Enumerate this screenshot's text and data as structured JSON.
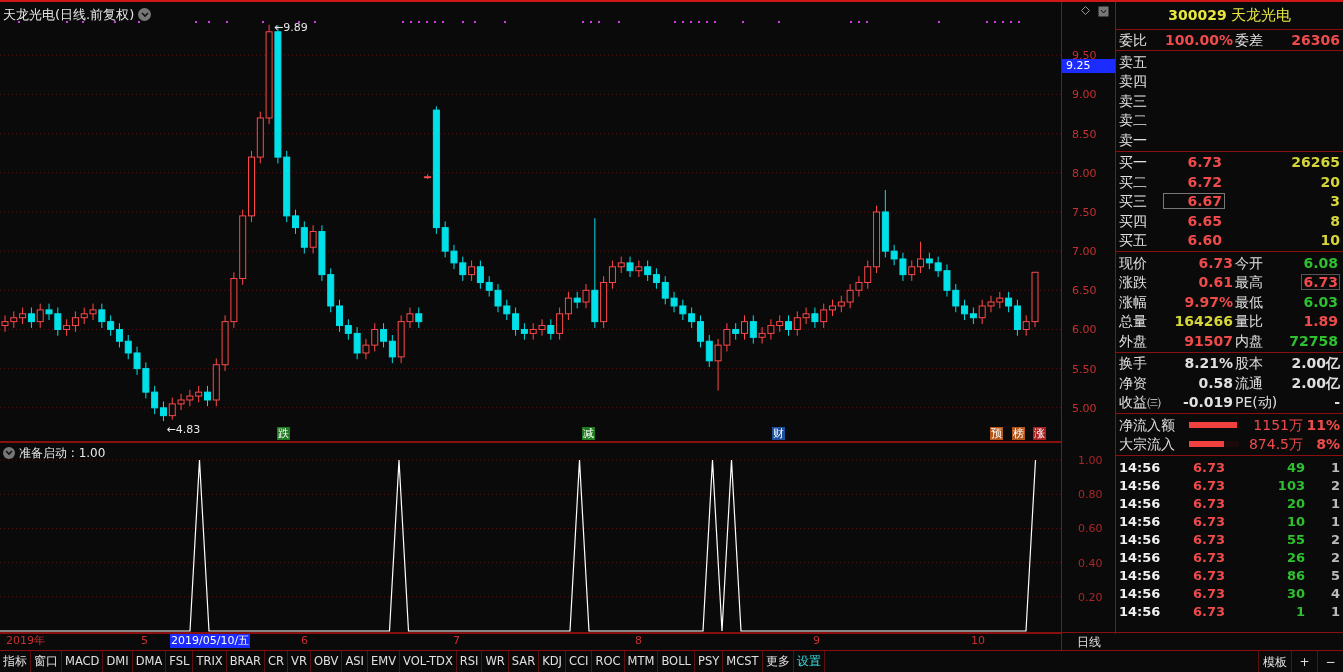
{
  "chart_title": "天龙光电(日线.前复权)",
  "price_chart": {
    "high_label": "←9.89",
    "low_label": "←4.83",
    "cursor_price": "9.25",
    "chart_data": {
      "type": "candlestick",
      "ylim": [
        4.57,
        10.18
      ],
      "grid": true,
      "yticks": [
        {
          "value": 9.5,
          "label": "9.50"
        },
        {
          "value": 9.0,
          "label": "9.00"
        },
        {
          "value": 8.5,
          "label": "8.50"
        },
        {
          "value": 8.0,
          "label": "8.00"
        },
        {
          "value": 7.5,
          "label": "7.50"
        },
        {
          "value": 7.0,
          "label": "7.00"
        },
        {
          "value": 6.5,
          "label": "6.50"
        },
        {
          "value": 6.0,
          "label": "6.00"
        },
        {
          "value": 5.5,
          "label": "5.50"
        },
        {
          "value": 5.0,
          "label": "5.00"
        }
      ],
      "ohlc": [
        [
          6.05,
          6.18,
          5.97,
          6.1
        ],
        [
          6.1,
          6.23,
          6.02,
          6.15
        ],
        [
          6.15,
          6.28,
          6.07,
          6.2
        ],
        [
          6.2,
          6.28,
          6.02,
          6.1
        ],
        [
          6.1,
          6.33,
          6.02,
          6.25
        ],
        [
          6.25,
          6.33,
          6.12,
          6.2
        ],
        [
          6.2,
          6.28,
          5.92,
          6.0
        ],
        [
          6.0,
          6.13,
          5.92,
          6.05
        ],
        [
          6.05,
          6.23,
          5.97,
          6.15
        ],
        [
          6.15,
          6.28,
          6.07,
          6.2
        ],
        [
          6.2,
          6.33,
          6.12,
          6.25
        ],
        [
          6.25,
          6.33,
          6.02,
          6.1
        ],
        [
          6.1,
          6.18,
          5.92,
          6.0
        ],
        [
          6.0,
          6.08,
          5.77,
          5.85
        ],
        [
          5.85,
          5.93,
          5.62,
          5.7
        ],
        [
          5.7,
          5.78,
          5.42,
          5.5
        ],
        [
          5.5,
          5.58,
          5.12,
          5.2
        ],
        [
          5.2,
          5.28,
          4.92,
          5.0
        ],
        [
          5.0,
          5.08,
          4.83,
          4.9
        ],
        [
          4.9,
          5.13,
          4.85,
          5.05
        ],
        [
          5.05,
          5.18,
          4.97,
          5.1
        ],
        [
          5.1,
          5.23,
          5.02,
          5.15
        ],
        [
          5.15,
          5.28,
          5.07,
          5.2
        ],
        [
          5.2,
          5.28,
          5.02,
          5.1
        ],
        [
          5.1,
          5.63,
          5.02,
          5.55
        ],
        [
          5.55,
          6.18,
          5.47,
          6.1
        ],
        [
          6.1,
          6.73,
          6.02,
          6.65
        ],
        [
          6.65,
          7.53,
          6.57,
          7.45
        ],
        [
          7.45,
          8.28,
          7.37,
          8.2
        ],
        [
          8.2,
          8.78,
          8.12,
          8.7
        ],
        [
          8.7,
          9.89,
          8.62,
          9.8
        ],
        [
          9.8,
          9.88,
          8.12,
          8.2
        ],
        [
          8.2,
          8.28,
          7.37,
          7.45
        ],
        [
          7.45,
          7.53,
          7.22,
          7.3
        ],
        [
          7.3,
          7.38,
          6.97,
          7.05
        ],
        [
          7.05,
          7.33,
          6.97,
          7.25
        ],
        [
          7.25,
          7.33,
          6.62,
          6.7
        ],
        [
          6.7,
          6.78,
          6.22,
          6.3
        ],
        [
          6.3,
          6.38,
          5.97,
          6.05
        ],
        [
          6.05,
          6.13,
          5.87,
          5.95
        ],
        [
          5.95,
          6.03,
          5.62,
          5.7
        ],
        [
          5.7,
          5.88,
          5.62,
          5.8
        ],
        [
          5.8,
          6.08,
          5.72,
          6.0
        ],
        [
          6.0,
          6.08,
          5.77,
          5.85
        ],
        [
          5.85,
          5.93,
          5.57,
          5.65
        ],
        [
          5.65,
          6.18,
          5.57,
          6.1
        ],
        [
          6.1,
          6.28,
          6.02,
          6.2
        ],
        [
          6.2,
          6.28,
          6.02,
          6.1
        ],
        [
          7.95,
          7.98,
          7.92,
          7.95
        ],
        [
          8.8,
          8.85,
          7.22,
          7.3
        ],
        [
          7.3,
          7.38,
          6.92,
          7.0
        ],
        [
          7.0,
          7.08,
          6.77,
          6.85
        ],
        [
          6.85,
          6.93,
          6.62,
          6.7
        ],
        [
          6.7,
          6.88,
          6.62,
          6.8
        ],
        [
          6.8,
          6.88,
          6.52,
          6.6
        ],
        [
          6.6,
          6.68,
          6.42,
          6.5
        ],
        [
          6.5,
          6.58,
          6.22,
          6.3
        ],
        [
          6.3,
          6.38,
          6.12,
          6.2
        ],
        [
          6.2,
          6.28,
          5.92,
          6.0
        ],
        [
          6.0,
          6.08,
          5.87,
          5.95
        ],
        [
          5.95,
          6.08,
          5.87,
          6.0
        ],
        [
          6.0,
          6.13,
          5.92,
          6.05
        ],
        [
          6.05,
          6.13,
          5.87,
          5.95
        ],
        [
          5.95,
          6.28,
          5.87,
          6.2
        ],
        [
          6.2,
          6.48,
          6.12,
          6.4
        ],
        [
          6.4,
          6.48,
          6.27,
          6.35
        ],
        [
          6.35,
          6.58,
          6.27,
          6.5
        ],
        [
          6.5,
          7.42,
          6.02,
          6.1
        ],
        [
          6.1,
          6.68,
          6.02,
          6.6
        ],
        [
          6.6,
          6.88,
          6.52,
          6.8
        ],
        [
          6.8,
          6.93,
          6.72,
          6.85
        ],
        [
          6.85,
          6.93,
          6.67,
          6.75
        ],
        [
          6.75,
          6.88,
          6.67,
          6.8
        ],
        [
          6.8,
          6.88,
          6.62,
          6.7
        ],
        [
          6.7,
          6.78,
          6.52,
          6.6
        ],
        [
          6.6,
          6.68,
          6.32,
          6.4
        ],
        [
          6.4,
          6.48,
          6.22,
          6.3
        ],
        [
          6.3,
          6.38,
          6.12,
          6.2
        ],
        [
          6.2,
          6.28,
          6.02,
          6.1
        ],
        [
          6.1,
          6.18,
          5.77,
          5.85
        ],
        [
          5.85,
          5.93,
          5.52,
          5.6
        ],
        [
          5.6,
          5.88,
          5.22,
          5.8
        ],
        [
          5.8,
          6.08,
          5.72,
          6.0
        ],
        [
          6.0,
          6.08,
          5.87,
          5.95
        ],
        [
          5.95,
          6.18,
          5.87,
          6.1
        ],
        [
          6.1,
          6.18,
          5.82,
          5.9
        ],
        [
          5.9,
          6.03,
          5.82,
          5.95
        ],
        [
          5.95,
          6.13,
          5.87,
          6.05
        ],
        [
          6.05,
          6.18,
          5.97,
          6.1
        ],
        [
          6.1,
          6.18,
          5.92,
          6.0
        ],
        [
          6.0,
          6.23,
          5.92,
          6.15
        ],
        [
          6.15,
          6.28,
          6.07,
          6.2
        ],
        [
          6.2,
          6.28,
          6.02,
          6.1
        ],
        [
          6.1,
          6.33,
          6.02,
          6.25
        ],
        [
          6.25,
          6.38,
          6.17,
          6.3
        ],
        [
          6.3,
          6.43,
          6.22,
          6.35
        ],
        [
          6.35,
          6.58,
          6.27,
          6.5
        ],
        [
          6.5,
          6.68,
          6.42,
          6.6
        ],
        [
          6.6,
          6.88,
          6.52,
          6.8
        ],
        [
          6.8,
          7.58,
          6.72,
          7.5
        ],
        [
          7.5,
          7.78,
          6.92,
          7.0
        ],
        [
          7.0,
          7.08,
          6.82,
          6.9
        ],
        [
          6.9,
          6.98,
          6.62,
          6.7
        ],
        [
          6.7,
          6.88,
          6.62,
          6.8
        ],
        [
          6.8,
          7.12,
          6.72,
          6.9
        ],
        [
          6.9,
          6.98,
          6.77,
          6.85
        ],
        [
          6.85,
          6.93,
          6.67,
          6.75
        ],
        [
          6.75,
          6.83,
          6.42,
          6.5
        ],
        [
          6.5,
          6.58,
          6.22,
          6.3
        ],
        [
          6.3,
          6.38,
          6.12,
          6.2
        ],
        [
          6.2,
          6.28,
          6.07,
          6.15
        ],
        [
          6.15,
          6.38,
          6.07,
          6.3
        ],
        [
          6.3,
          6.43,
          6.22,
          6.35
        ],
        [
          6.35,
          6.48,
          6.27,
          6.4
        ],
        [
          6.4,
          6.48,
          6.22,
          6.3
        ],
        [
          6.3,
          6.38,
          5.92,
          6.0
        ],
        [
          6.0,
          6.18,
          5.92,
          6.1
        ],
        [
          6.1,
          6.73,
          6.03,
          6.73
        ]
      ]
    },
    "events": [
      {
        "label": "跌",
        "color": "#1f7a1f"
      },
      {
        "label": "减",
        "color": "#1f7a1f"
      },
      {
        "label": "财",
        "color": "#1c4f9c"
      },
      {
        "label": "预",
        "color": "#b3561a"
      },
      {
        "label": "榜",
        "color": "#b3561a"
      },
      {
        "label": "涨",
        "color": "#a82020"
      }
    ]
  },
  "indicator": {
    "chart_data": {
      "type": "line",
      "title": "准备启动 : 1.00",
      "ylim": [
        0,
        1.1
      ],
      "grid": true,
      "yticks": [
        {
          "value": 0.2,
          "label": "0.20"
        },
        {
          "value": 0.4,
          "label": "0.40"
        },
        {
          "value": 0.6,
          "label": "0.60"
        },
        {
          "value": 0.8,
          "label": "0.80"
        },
        {
          "value": 1.0,
          "label": "1.00"
        }
      ],
      "series": [
        {
          "color": "#ffffff",
          "values": [
            0,
            0,
            0,
            0,
            0,
            0,
            0,
            0,
            0,
            0,
            0,
            0,
            0,
            0,
            0,
            0,
            0,
            0,
            0,
            0,
            0,
            1,
            0,
            0,
            0,
            0,
            0,
            0,
            0,
            0,
            0,
            0,
            0,
            0,
            0,
            0,
            0,
            0,
            0,
            0,
            0,
            0,
            1,
            0,
            0,
            0,
            0,
            0,
            0,
            0,
            0,
            0,
            0,
            0,
            0,
            0,
            0,
            0,
            0,
            0,
            0,
            1,
            0,
            0,
            0,
            0,
            0,
            0,
            0,
            0,
            0,
            0,
            0,
            0,
            0,
            1,
            0,
            1,
            0,
            0,
            0,
            0,
            0,
            0,
            0,
            0,
            0,
            0,
            0,
            0,
            0,
            0,
            0,
            0,
            0,
            0,
            0,
            0,
            0,
            0,
            0,
            0,
            0,
            0,
            0,
            0,
            0,
            0,
            0,
            1
          ]
        }
      ]
    }
  },
  "date_axis": [
    {
      "label": "2019年",
      "selected": false
    },
    {
      "label": "5",
      "selected": false
    },
    {
      "label": "2019/05/10/五",
      "selected": true
    },
    {
      "label": "6",
      "selected": false
    },
    {
      "label": "7",
      "selected": false
    },
    {
      "label": "8",
      "selected": false
    },
    {
      "label": "9",
      "selected": false
    },
    {
      "label": "10",
      "selected": false
    }
  ],
  "period": "日线",
  "toolbar": [
    {
      "label": "指标",
      "selected": false
    },
    {
      "label": "窗口",
      "selected": false
    },
    {
      "label": "MACD",
      "selected": false
    },
    {
      "label": "DMI",
      "selected": false
    },
    {
      "label": "DMA",
      "selected": false
    },
    {
      "label": "FSL",
      "selected": false
    },
    {
      "label": "TRIX",
      "selected": false
    },
    {
      "label": "BRAR",
      "selected": false
    },
    {
      "label": "CR",
      "selected": false
    },
    {
      "label": "VR",
      "selected": false
    },
    {
      "label": "OBV",
      "selected": false
    },
    {
      "label": "ASI",
      "selected": false
    },
    {
      "label": "EMV",
      "selected": false
    },
    {
      "label": "VOL-TDX",
      "selected": false
    },
    {
      "label": "RSI",
      "selected": false
    },
    {
      "label": "WR",
      "selected": false
    },
    {
      "label": "SAR",
      "selected": false
    },
    {
      "label": "KDJ",
      "selected": false
    },
    {
      "label": "CCI",
      "selected": false
    },
    {
      "label": "ROC",
      "selected": false
    },
    {
      "label": "MTM",
      "selected": false
    },
    {
      "label": "BOLL",
      "selected": false
    },
    {
      "label": "PSY",
      "selected": false
    },
    {
      "label": "MCST",
      "selected": false
    },
    {
      "label": "更多",
      "selected": false
    },
    {
      "label": "设置",
      "selected": true
    }
  ],
  "toolbar_right": [
    "模板",
    "+",
    "−"
  ],
  "quote": {
    "code": "300029",
    "name": "天龙光电",
    "ratio": [
      {
        "label": "委比",
        "value": "100.00%"
      },
      {
        "label": "委差",
        "value": "26306"
      }
    ],
    "sell": [
      "卖五",
      "卖四",
      "卖三",
      "卖二",
      "卖一"
    ],
    "buy": [
      {
        "label": "买一",
        "price": "6.73",
        "volume": "26265",
        "selected": false
      },
      {
        "label": "买二",
        "price": "6.72",
        "volume": "20",
        "selected": false
      },
      {
        "label": "买三",
        "price": "6.67",
        "volume": "3",
        "selected": true
      },
      {
        "label": "买四",
        "price": "6.65",
        "volume": "8",
        "selected": false
      },
      {
        "label": "买五",
        "price": "6.60",
        "volume": "10",
        "selected": false
      }
    ],
    "stats": [
      {
        "left": {
          "label": "现价",
          "value": "6.73",
          "color": "#ef4b4b"
        },
        "right": {
          "label": "今开",
          "value": "6.08",
          "color": "#2fc02f",
          "highlighted": false
        }
      },
      {
        "left": {
          "label": "涨跌",
          "value": "0.61",
          "color": "#ef4b4b"
        },
        "right": {
          "label": "最高",
          "value": "6.73",
          "color": "#ef4b4b",
          "highlighted": true
        }
      },
      {
        "left": {
          "label": "涨幅",
          "value": "9.97%",
          "color": "#ef4b4b"
        },
        "right": {
          "label": "最低",
          "value": "6.03",
          "color": "#2fc02f",
          "highlighted": false
        }
      },
      {
        "left": {
          "label": "总量",
          "value": "164266",
          "color": "#d6d63a"
        },
        "right": {
          "label": "量比",
          "value": "1.89",
          "color": "#ef4b4b",
          "highlighted": false
        }
      },
      {
        "left": {
          "label": "外盘",
          "value": "91507",
          "color": "#ef4b4b"
        },
        "right": {
          "label": "内盘",
          "value": "72758",
          "color": "#2fc02f",
          "highlighted": false
        }
      }
    ],
    "shares": [
      {
        "label": "换手",
        "value": "8.21%",
        "label2": "股本",
        "value2": "2.00亿"
      },
      {
        "label": "净资",
        "value": "0.58",
        "label2": "流通",
        "value2": "2.00亿"
      },
      {
        "label": "收益㈢",
        "value": "-0.019",
        "label2": "PE(动)",
        "value2": "-"
      }
    ],
    "flows": [
      {
        "label": "净流入额",
        "level": 0.95,
        "amount": "1151万",
        "percent": "11%"
      },
      {
        "label": "大宗流入",
        "level": 0.7,
        "amount": "874.5万",
        "percent": "8%"
      }
    ],
    "ticks": [
      {
        "time": "14:56",
        "price": "6.73",
        "volume": "49",
        "count": "1"
      },
      {
        "time": "14:56",
        "price": "6.73",
        "volume": "103",
        "count": "2"
      },
      {
        "time": "14:56",
        "price": "6.73",
        "volume": "20",
        "count": "1"
      },
      {
        "time": "14:56",
        "price": "6.73",
        "volume": "10",
        "count": "1"
      },
      {
        "time": "14:56",
        "price": "6.73",
        "volume": "55",
        "count": "2"
      },
      {
        "time": "14:56",
        "price": "6.73",
        "volume": "26",
        "count": "2"
      },
      {
        "time": "14:56",
        "price": "6.73",
        "volume": "86",
        "count": "5"
      },
      {
        "time": "14:56",
        "price": "6.73",
        "volume": "30",
        "count": "4"
      },
      {
        "time": "14:56",
        "price": "6.73",
        "volume": "1",
        "count": "1"
      }
    ]
  }
}
